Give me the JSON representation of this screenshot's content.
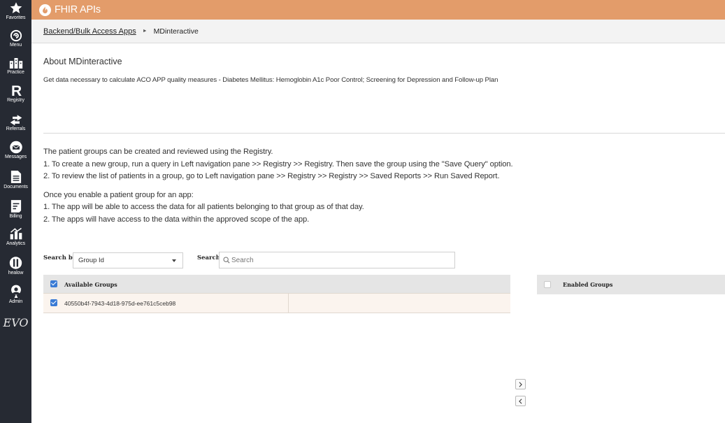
{
  "sidebar": {
    "items": [
      {
        "label": "Favorites",
        "icon": "star-icon"
      },
      {
        "label": "Menu",
        "icon": "menu-swirl-icon"
      },
      {
        "label": "Practice",
        "icon": "practice-building-icon"
      },
      {
        "label": "Registry",
        "icon": "registry-r-icon"
      },
      {
        "label": "Referrals",
        "icon": "referrals-arrows-icon"
      },
      {
        "label": "Messages",
        "icon": "messages-envelope-icon"
      },
      {
        "label": "Documents",
        "icon": "documents-icon"
      },
      {
        "label": "Billing",
        "icon": "billing-icon"
      },
      {
        "label": "Analytics",
        "icon": "analytics-icon"
      },
      {
        "label": "healow",
        "icon": "healow-icon"
      },
      {
        "label": "Admin",
        "icon": "admin-person-icon"
      }
    ],
    "footer_logo": "EVO"
  },
  "header": {
    "title": "FHIR APIs",
    "icon": "fhir-flame-icon"
  },
  "breadcrumb": {
    "parent": "Backend/Bulk Access Apps",
    "current": "MDinteractive"
  },
  "about": {
    "title": "About MDinteractive",
    "description": "Get data necessary to calculate ACO APP quality measures - Diabetes Mellitus: Hemoglobin A1c Poor Control; Screening for Depression and Follow-up Plan"
  },
  "instructions": {
    "lines1": [
      "The patient groups can be created and reviewed using the Registry.",
      "1. To create a new group, run a query in Left navigation pane >> Registry >> Registry. Then save the group using the \"Save Query\" option.",
      "2. To review the list of patients in a group, go to Left navigation pane >> Registry >> Registry >> Saved Reports >> Run Saved Report."
    ],
    "lines2": [
      "Once you enable a patient group for an app:",
      "1. The app will be able to access the data for all patients belonging to that group as of that day.",
      "2. The apps will have access to the data within the approved scope of the app."
    ]
  },
  "search": {
    "search_by_label": "Search by",
    "search_by_value": "Group Id",
    "search_label": "Search",
    "placeholder": "Search",
    "value": ""
  },
  "available_groups": {
    "header": "Available Groups",
    "header_checked": true,
    "rows": [
      {
        "id": "40550b4f-7943-4d18-975d-ee761c5ceb98",
        "checked": true
      }
    ]
  },
  "enabled_groups": {
    "header": "Enabled Groups",
    "header_checked": false,
    "rows": []
  },
  "colors": {
    "header_bg": "#e39c6a",
    "sidebar_bg": "#262a33",
    "checkbox_blue": "#3a7bd5",
    "row_bg": "#fbf4ee"
  }
}
